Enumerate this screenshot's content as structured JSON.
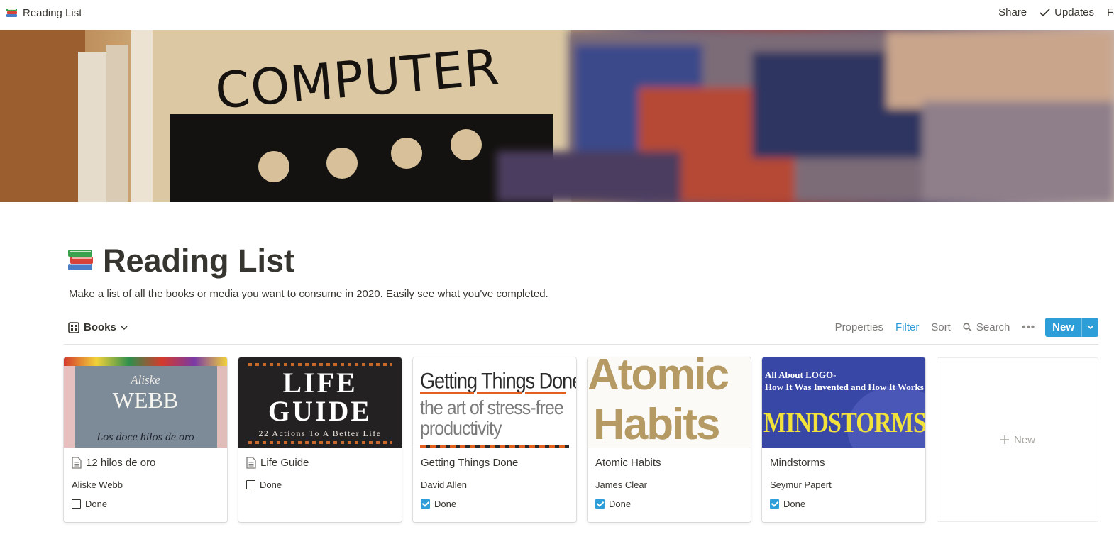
{
  "topbar": {
    "title": "Reading List",
    "share": "Share",
    "updates": "Updates",
    "favorite_partial": "Fa"
  },
  "page": {
    "title": "Reading List",
    "description": "Make a list of all the books or media you want to consume in 2020. Easily see what you've completed.",
    "icon": "books-emoji"
  },
  "view": {
    "name": "Books",
    "icon": "gallery-icon",
    "actions": {
      "properties": "Properties",
      "filter": "Filter",
      "sort": "Sort",
      "search": "Search",
      "more": "•••",
      "new": "New"
    }
  },
  "cover_text": "COMPUTER",
  "cards": [
    {
      "title": "12 hilos de oro",
      "author": "Aliske Webb",
      "done_label": "Done",
      "done": false,
      "has_page_icon": true,
      "cover": {
        "line1": "Aliske",
        "line2": "WEBB",
        "line3": "Los doce hilos de oro"
      }
    },
    {
      "title": "Life Guide",
      "author": "",
      "done_label": "Done",
      "done": false,
      "has_page_icon": true,
      "cover": {
        "line1": "LIFE",
        "line2": "GUIDE",
        "line3": "22 Actions To A Better Life"
      }
    },
    {
      "title": "Getting Things Done",
      "author": "David Allen",
      "done_label": "Done",
      "done": true,
      "has_page_icon": false,
      "cover": {
        "line1": "Getting Things Done",
        "line2": "the art of stress-free",
        "line3": "productivity"
      }
    },
    {
      "title": "Atomic Habits",
      "author": "James Clear",
      "done_label": "Done",
      "done": true,
      "has_page_icon": false,
      "cover": {
        "line1": "Atomic",
        "line2": "Habits"
      }
    },
    {
      "title": "Mindstorms",
      "author": "Seymur Papert",
      "done_label": "Done",
      "done": true,
      "has_page_icon": false,
      "cover": {
        "line1": "All About LOGO-",
        "line2": "How It Was Invented and How It Works",
        "line3": "MINDSTORMS"
      }
    }
  ],
  "new_card_label": "New",
  "colors": {
    "accent": "#2e9ed8",
    "text": "#37352f",
    "muted": "#7d7c78"
  }
}
